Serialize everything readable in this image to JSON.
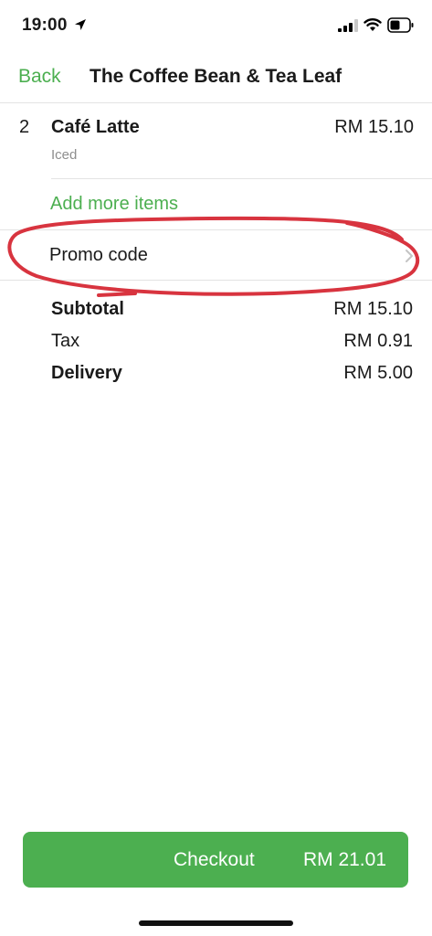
{
  "status_bar": {
    "time": "19:00",
    "icons": [
      "location-arrow-icon",
      "signal-icon",
      "wifi-icon",
      "battery-icon"
    ]
  },
  "nav": {
    "back_label": "Back",
    "title": "The Coffee Bean & Tea Leaf"
  },
  "order": {
    "items": [
      {
        "qty": "2",
        "name": "Café Latte",
        "modifier": "Iced",
        "price": "RM 15.10"
      }
    ],
    "add_more_label": "Add more items"
  },
  "promo": {
    "label": "Promo code",
    "icon": "chevron-right-icon"
  },
  "totals": {
    "subtotal_label": "Subtotal",
    "subtotal_value": "RM 15.10",
    "tax_label": "Tax",
    "tax_value": "RM 0.91",
    "delivery_label": "Delivery",
    "delivery_value": "RM 5.00"
  },
  "checkout": {
    "label": "Checkout",
    "total": "RM 21.01"
  },
  "colors": {
    "accent": "#4caf50",
    "annotation": "#d8343f",
    "divider": "#e3e3e3",
    "muted_text": "#8e8e8e"
  }
}
